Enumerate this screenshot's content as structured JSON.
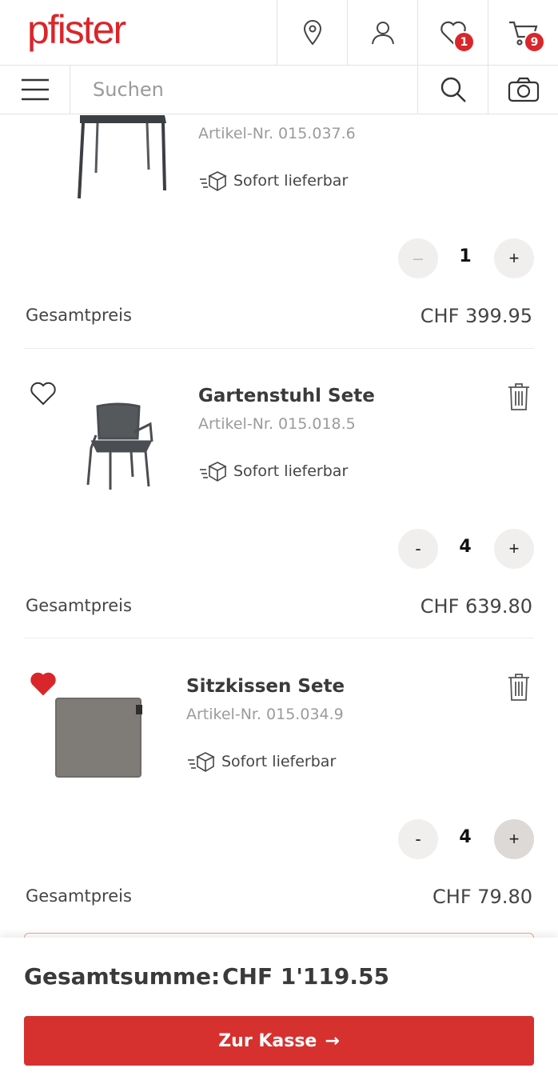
{
  "header": {
    "logo_text": "pfister",
    "wishlist_count": "1",
    "cart_count": "9",
    "brand_color": "#d9262b"
  },
  "search": {
    "placeholder": "Suchen"
  },
  "items": [
    {
      "name": "",
      "article_number": "Artikel-Nr. 015.037.6",
      "availability": "Sofort lieferbar",
      "quantity": "1",
      "minus_label": "–",
      "plus_label": "+",
      "total_label": "Gesamtpreis",
      "total_price": "CHF 399.95",
      "favorited": false
    },
    {
      "name": "Gartenstuhl Sete",
      "article_number": "Artikel-Nr. 015.018.5",
      "availability": "Sofort lieferbar",
      "quantity": "4",
      "minus_label": "-",
      "plus_label": "+",
      "total_label": "Gesamtpreis",
      "total_price": "CHF 639.80",
      "favorited": false
    },
    {
      "name": "Sitzkissen Sete",
      "article_number": "Artikel-Nr. 015.034.9",
      "availability": "Sofort lieferbar",
      "quantity": "4",
      "minus_label": "-",
      "plus_label": "+",
      "total_label": "Gesamtpreis",
      "total_price": "CHF 79.80",
      "favorited": true
    }
  ],
  "footer": {
    "sum_label": "Gesamtsumme:",
    "sum_value": "CHF 1'119.55",
    "checkout_label": "Zur Kasse",
    "checkout_arrow": "→",
    "button_color": "#d6302f"
  }
}
